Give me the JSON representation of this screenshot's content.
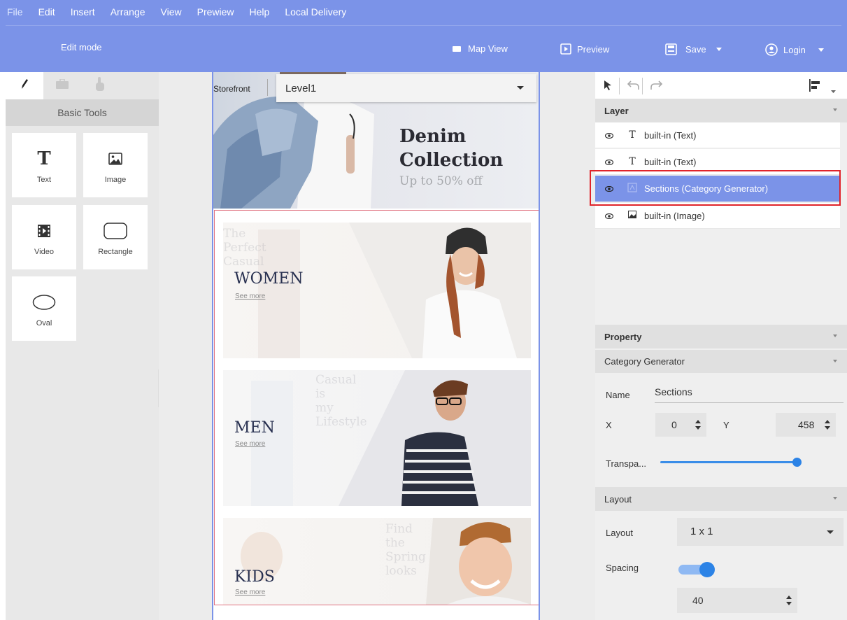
{
  "menu": {
    "items": [
      {
        "label": "File"
      },
      {
        "label": "Edit"
      },
      {
        "label": "Insert"
      },
      {
        "label": "Arrange"
      },
      {
        "label": "View"
      },
      {
        "label": "Prewiew"
      },
      {
        "label": "Help"
      },
      {
        "label": "Local Delivery"
      }
    ]
  },
  "topbar": {
    "mode_label": "Edit mode",
    "map_view": "Map View",
    "preview": "Preview",
    "save": "Save",
    "login": "Login"
  },
  "left_panel": {
    "section_title": "Basic Tools",
    "tools": [
      {
        "label": "Text",
        "icon": "text-icon"
      },
      {
        "label": "Image",
        "icon": "image-icon"
      },
      {
        "label": "Video",
        "icon": "video-icon"
      },
      {
        "label": "Rectangle",
        "icon": "rectangle-icon"
      },
      {
        "label": "Oval",
        "icon": "oval-icon"
      }
    ]
  },
  "canvas": {
    "storefront_label": "Storefront",
    "level_value": "Level1",
    "hero": {
      "title_line1": "Denim",
      "title_line2": "Collection",
      "subtitle": "Up to 50% off"
    },
    "categories": [
      {
        "name": "WOMEN",
        "link": "See more",
        "ghost": "The Perfect Casual"
      },
      {
        "name": "MEN",
        "link": "See more",
        "ghost": "Casual is my Lifestyle"
      },
      {
        "name": "KIDS",
        "link": "See more",
        "ghost": "Find the Spring looks"
      }
    ]
  },
  "right_panel": {
    "layer_title": "Layer",
    "layers": [
      {
        "type": "T",
        "name": "built-in (Text)",
        "selected": false
      },
      {
        "type": "T",
        "name": "built-in (Text)",
        "selected": false
      },
      {
        "type": "section",
        "name": "Sections (Category Generator)",
        "selected": true
      },
      {
        "type": "image",
        "name": "built-in (Image)",
        "selected": false
      }
    ],
    "property_title": "Property",
    "component_title": "Category Generator",
    "name_label": "Name",
    "name_value": "Sections",
    "x_label": "X",
    "x_value": "0",
    "y_label": "Y",
    "y_value": "458",
    "transparency_label": "Transpa...",
    "transparency_level": 1.0,
    "layout_title": "Layout",
    "layout_label": "Layout",
    "layout_value": "1 x 1",
    "spacing_label": "Spacing",
    "spacing_enabled": true,
    "spacing_value": "40"
  },
  "colors": {
    "accent": "#7b93e8",
    "selection_outline": "#e0232a",
    "section_border": "#e07280",
    "control_blue": "#2c83e6"
  }
}
